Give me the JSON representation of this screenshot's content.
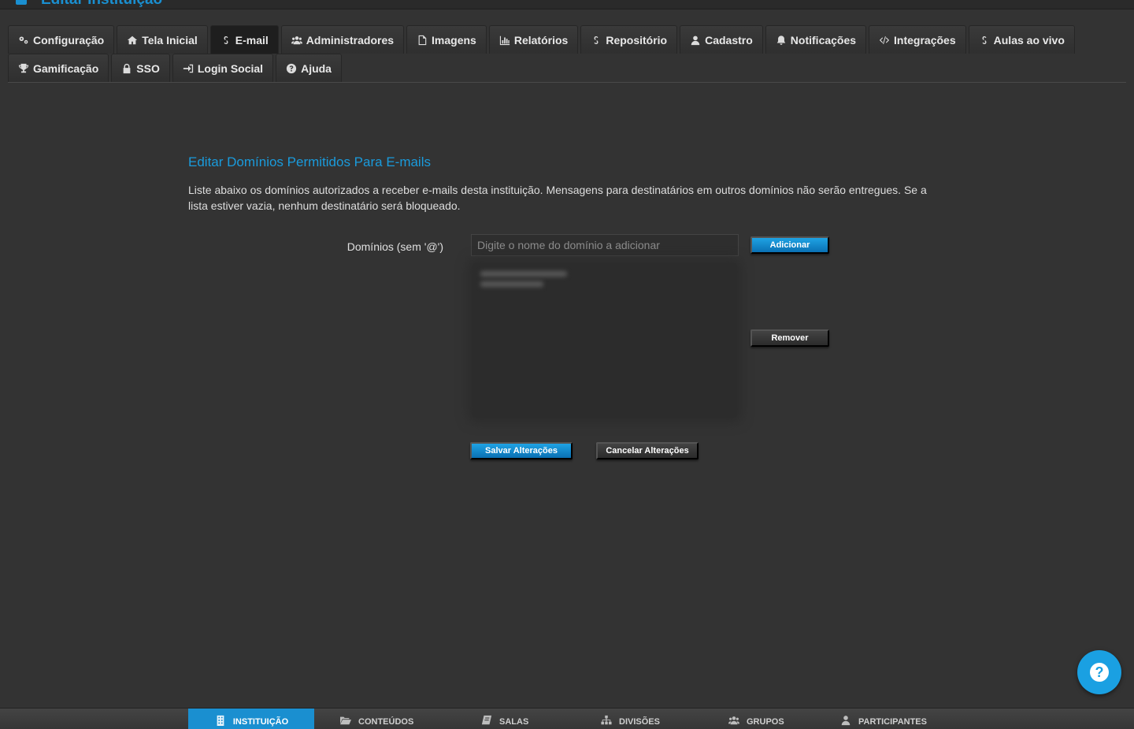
{
  "header": {
    "title": "Editar Instituição"
  },
  "tabs": {
    "configuracao": "Configuração",
    "tela_inicial": "Tela Inicial",
    "email": "E-mail",
    "administradores": "Administradores",
    "imagens": "Imagens",
    "relatorios": "Relatórios",
    "repositorio": "Repositório",
    "cadastro": "Cadastro",
    "notificacoes": "Notificações",
    "integracoes": "Integrações",
    "aulas_ao_vivo": "Aulas ao vivo",
    "gamificacao": "Gamificação",
    "sso": "SSO",
    "login_social": "Login Social",
    "ajuda": "Ajuda",
    "active": "E-mail"
  },
  "email_domains": {
    "title": "Editar Domínios Permitidos Para E-mails",
    "description": "Liste abaixo os domínios autorizados a receber e-mails desta instituição. Mensagens para destinatários em outros domínios não serão entregues. Se a lista estiver vazia, nenhum destinatário será bloqueado.",
    "field_label": "Domínios (sem '@')",
    "input_placeholder": "Digite o nome do domínio a adicionar",
    "input_value": "",
    "add_button": "Adicionar",
    "remove_button": "Remover",
    "save_button": "Salvar Alterações",
    "cancel_button": "Cancelar Alterações"
  },
  "help": {
    "icon": "question-circle-icon"
  },
  "bottom_nav": {
    "instituicao": "INSTITUIÇÃO",
    "conteudos": "CONTEÚDOS",
    "salas": "SALAS",
    "divisoes": "DIVISÕES",
    "grupos": "GRUPOS",
    "participantes": "PARTICIPANTES",
    "active": "INSTITUIÇÃO"
  },
  "colors": {
    "accent": "#1a9bdc",
    "background": "#333333",
    "button_blue": "#0a70b3"
  }
}
